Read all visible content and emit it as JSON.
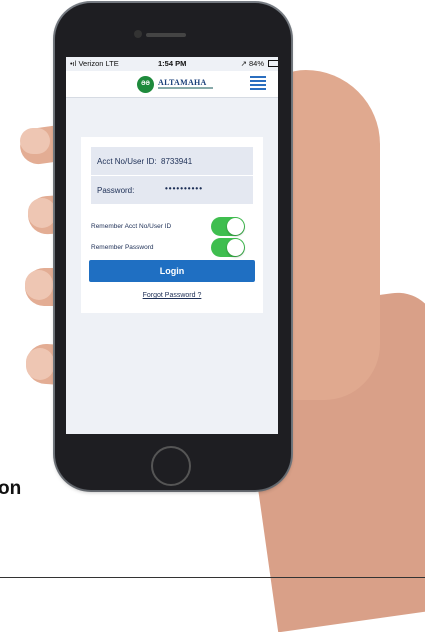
{
  "status_bar": {
    "carrier": "•ıl Verizon  LTE",
    "time": "1:54 PM",
    "battery": "↗ 84%"
  },
  "header": {
    "logo_badge": "ƏƏ",
    "logo_text": "ALTAMAHA",
    "menu_icon": "hamburger-menu-icon"
  },
  "login_form": {
    "acct_label": "Acct No/User ID:",
    "acct_value": "8733941",
    "password_label": "Password:",
    "password_value": "••••••••••",
    "remember_acct_label": "Remember Acct No/User ID",
    "remember_acct_on": true,
    "remember_password_label": "Remember Password",
    "remember_password_on": true,
    "login_label": "Login",
    "forgot_label": "Forgot Password ?"
  },
  "side_text": "on",
  "colors": {
    "accent": "#1f6fc2",
    "toggle_on": "#3fbe4f",
    "logo_green": "#1e8a3c"
  }
}
